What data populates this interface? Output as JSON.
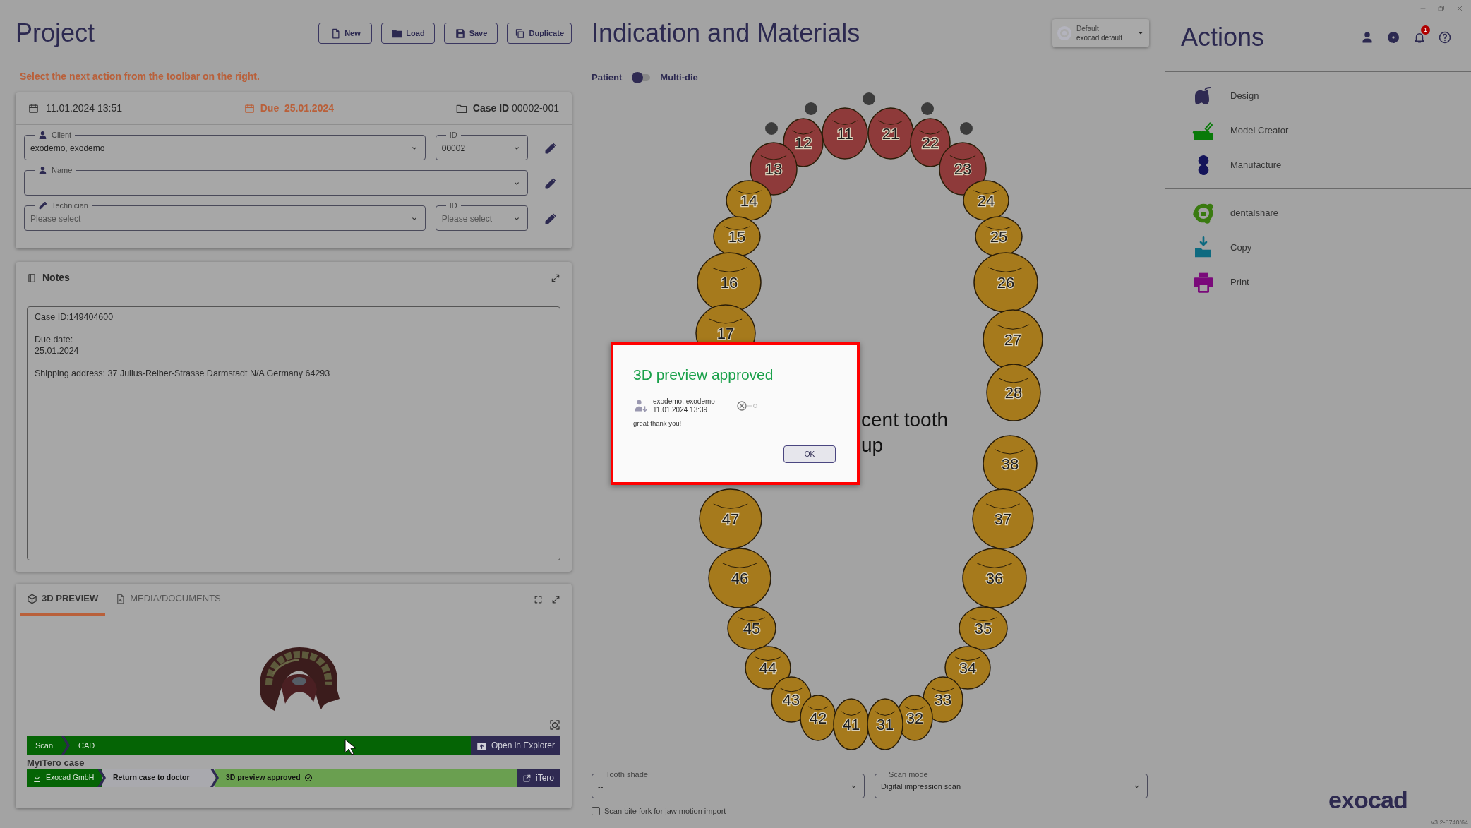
{
  "project": {
    "title": "Project",
    "buttons": [
      {
        "label": "New"
      },
      {
        "label": "Load"
      },
      {
        "label": "Save"
      },
      {
        "label": "Duplicate"
      }
    ],
    "message": "Select the next action from the toolbar on the right."
  },
  "case_card": {
    "created": "11.01.2024 13:51",
    "due_label": "Due",
    "due_date": "25.01.2024",
    "case_id_label": "Case ID",
    "case_id": "00002-001",
    "client": {
      "label": "Client",
      "value": "exodemo, exodemo"
    },
    "client_id": {
      "label": "ID",
      "value": "00002"
    },
    "name": {
      "label": "Name"
    },
    "technician": {
      "label": "Technician",
      "placeholder": "Please select"
    },
    "technician_id": {
      "label": "ID",
      "placeholder": "Please select"
    }
  },
  "notes": {
    "title": "Notes",
    "text": "Case ID:149404600\n\nDue date:\n25.01.2024\n\nShipping address: 37 Julius-Reiber-Strasse Darmstadt N/A Germany 64293"
  },
  "preview": {
    "tabs": [
      {
        "label": "3D PREVIEW",
        "selected": true
      },
      {
        "label": "MEDIA/DOCUMENTS",
        "selected": false
      }
    ],
    "workflow": {
      "steps": [
        "Scan",
        "CAD"
      ],
      "button": "Open in Explorer"
    },
    "itero": {
      "title": "MyiTero case",
      "steps": [
        {
          "label": "Exocad GmbH",
          "kind": "source"
        },
        {
          "label": "Return case to doctor",
          "kind": "pending"
        },
        {
          "label": "3D preview approved",
          "kind": "approved"
        }
      ],
      "button": "iTero"
    }
  },
  "indication": {
    "title": "Indication and Materials",
    "profile": {
      "name": "Default",
      "subtitle": "exocad default"
    },
    "toggle": {
      "left": "Patient",
      "right": "Multi-die",
      "on": false
    },
    "teeth": [
      {
        "number": "11",
        "selected": true
      },
      {
        "number": "21",
        "selected": true
      },
      {
        "number": "12",
        "selected": true
      },
      {
        "number": "22",
        "selected": true
      },
      {
        "number": "13",
        "selected": true
      },
      {
        "number": "23",
        "selected": true
      },
      {
        "number": "14",
        "selected": false
      },
      {
        "number": "24",
        "selected": false
      },
      {
        "number": "15",
        "selected": false
      },
      {
        "number": "25",
        "selected": false
      },
      {
        "number": "16",
        "selected": false
      },
      {
        "number": "26",
        "selected": false
      },
      {
        "number": "17",
        "selected": false
      },
      {
        "number": "27",
        "selected": false
      },
      {
        "number": "28",
        "selected": false
      },
      {
        "number": "38",
        "selected": false
      },
      {
        "number": "47",
        "selected": false
      },
      {
        "number": "37",
        "selected": false
      },
      {
        "number": "46",
        "selected": false
      },
      {
        "number": "36",
        "selected": false
      },
      {
        "number": "45",
        "selected": false
      },
      {
        "number": "35",
        "selected": false
      },
      {
        "number": "44",
        "selected": false
      },
      {
        "number": "34",
        "selected": false
      },
      {
        "number": "43",
        "selected": false
      },
      {
        "number": "33",
        "selected": false
      },
      {
        "number": "42",
        "selected": false
      },
      {
        "number": "32",
        "selected": false
      },
      {
        "number": "41",
        "selected": false
      },
      {
        "number": "31",
        "selected": false
      }
    ],
    "hint_lines": [
      "cent tooth",
      "up"
    ],
    "tooth_shade": {
      "label": "Tooth shade",
      "value": "--"
    },
    "scan_mode": {
      "label": "Scan mode",
      "value": "Digital impression scan"
    },
    "bite_fork": {
      "label": "Scan bite fork for jaw motion import",
      "checked": false
    }
  },
  "actions": {
    "title": "Actions",
    "notification_count": "1",
    "groups": [
      [
        {
          "label": "Design"
        },
        {
          "label": "Model Creator"
        },
        {
          "label": "Manufacture"
        }
      ],
      [
        {
          "label": "dentalshare"
        },
        {
          "label": "Copy"
        },
        {
          "label": "Print"
        }
      ]
    ]
  },
  "dialog": {
    "title": "3D preview approved",
    "author": "exodemo, exodemo",
    "time": "11.01.2024 13:39",
    "message": "great thank you!",
    "button": "OK"
  },
  "footer": {
    "logo": "exocad",
    "version": "v3.2-8740/64"
  }
}
